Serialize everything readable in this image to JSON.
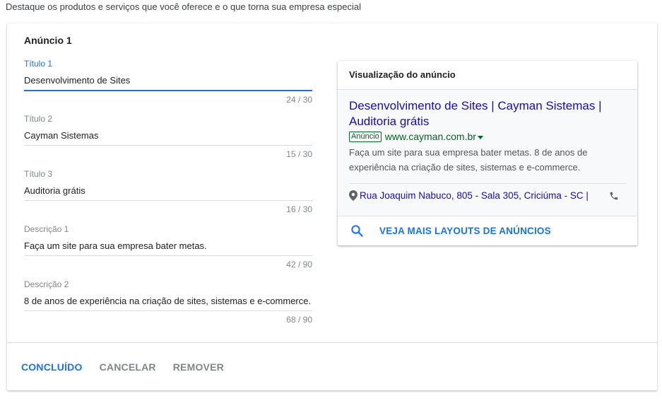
{
  "intro": "Destaque os produtos e serviços que você oferece e o que torna sua empresa especial",
  "card": {
    "title": "Anúncio 1",
    "fields": [
      {
        "label": "Título 1",
        "value": "Desenvolvimento de Sites",
        "counter": "24 / 30",
        "active": true
      },
      {
        "label": "Título 2",
        "value": "Cayman Sistemas",
        "counter": "15 / 30",
        "active": false
      },
      {
        "label": "Título 3",
        "value": "Auditoria grátis",
        "counter": "16 / 30",
        "active": false
      },
      {
        "label": "Descrição 1",
        "value": "Faça um site para sua empresa bater metas.",
        "counter": "42 / 90",
        "active": false
      },
      {
        "label": "Descrição 2",
        "value": "8 de anos de experiência na criação de sites, sistemas e e-commerce.",
        "counter": "68 / 90",
        "active": false
      }
    ],
    "actions": {
      "done": "CONCLUÍDO",
      "cancel": "CANCELAR",
      "remove": "REMOVER"
    }
  },
  "preview": {
    "header": "Visualização do anúncio",
    "headline": "Desenvolvimento de Sites | Cayman Sistemas | Auditoria grátis",
    "badge": "Anúncio",
    "url": "www.cayman.com.br",
    "description": "Faça um site para sua empresa bater metas. 8 de anos de experiência na criação de sites, sistemas e e-commerce.",
    "address": "Rua Joaquim Nabuco, 805 - Sala 305, Criciúma - SC |",
    "more_layouts": "VEJA MAIS LAYOUTS DE ANÚNCIOS",
    "icons": {
      "location": "location-pin-icon",
      "phone": "phone-icon",
      "search": "search-icon",
      "dropdown": "caret-down-icon"
    }
  },
  "colors": {
    "accent": "#1a73e8",
    "ad_title": "#1a0dab",
    "ad_url": "#006621",
    "muted": "#80868b"
  }
}
